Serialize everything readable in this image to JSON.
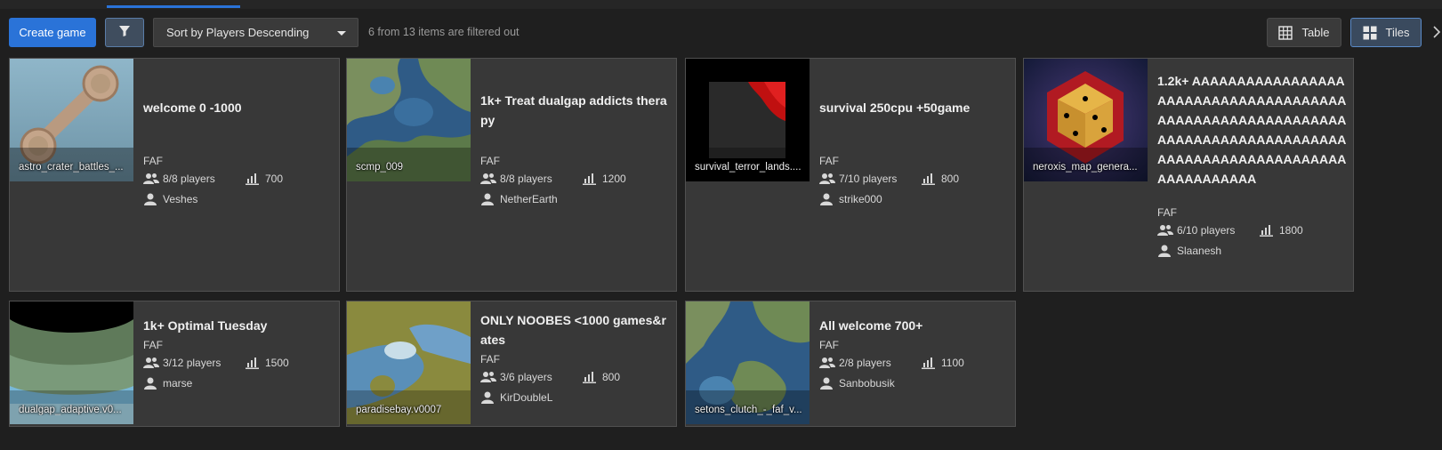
{
  "toolbar": {
    "create_label": "Create game",
    "sort_label": "Sort by Players Descending",
    "filter_info": "6 from 13 items are filtered out",
    "table_label": "Table",
    "tiles_label": "Tiles"
  },
  "games": [
    {
      "title": "welcome 0 -1000",
      "map": "astro_crater_battles_...",
      "mod": "FAF",
      "players": "8/8 players",
      "rating": "700",
      "host": "Veshes"
    },
    {
      "title": "1k+ Treat dualgap addicts therapy",
      "map": "scmp_009",
      "mod": "FAF",
      "players": "8/8 players",
      "rating": "1200",
      "host": "NetherEarth"
    },
    {
      "title": "survival 250cpu +50game",
      "map": "survival_terror_lands....",
      "mod": "FAF",
      "players": "7/10 players",
      "rating": "800",
      "host": "strike000"
    },
    {
      "title": "1.2k+ AAAAAAAAAAAAAAAAAAAAAAAAAAAAAAAAAAAAAAAAAAAAAAAAAAAAAAAAAAAAAAAAAAAAAAAAAAAAAAAAAAAAAAAAAAAAAAAAAAAAAAAAAAAAAAAA",
      "map": "neroxis_map_genera...",
      "mod": "FAF",
      "players": "6/10 players",
      "rating": "1800",
      "host": "Slaanesh"
    },
    {
      "title": "1k+ Optimal Tuesday",
      "map": "dualgap_adaptive.v0...",
      "mod": "FAF",
      "players": "3/12 players",
      "rating": "1500",
      "host": "marse"
    },
    {
      "title": "ONLY NOOBES <1000 games&rates",
      "map": "paradisebay.v0007",
      "mod": "FAF",
      "players": "3/6 players",
      "rating": "800",
      "host": "KirDoubleL"
    },
    {
      "title": "All welcome 700+",
      "map": "setons_clutch_-_faf_v...",
      "mod": "FAF",
      "players": "2/8 players",
      "rating": "1100",
      "host": "Sanbobusik"
    }
  ],
  "icons": {
    "filter": "filter-icon",
    "sort_caret": "chevron-down-icon",
    "table": "table-icon",
    "tiles": "tiles-icon",
    "players": "players-icon",
    "rating": "rating-icon",
    "host": "user-icon"
  },
  "colors": {
    "accent": "#2a73d8",
    "background": "#1f1f1f",
    "tile": "#383838"
  }
}
